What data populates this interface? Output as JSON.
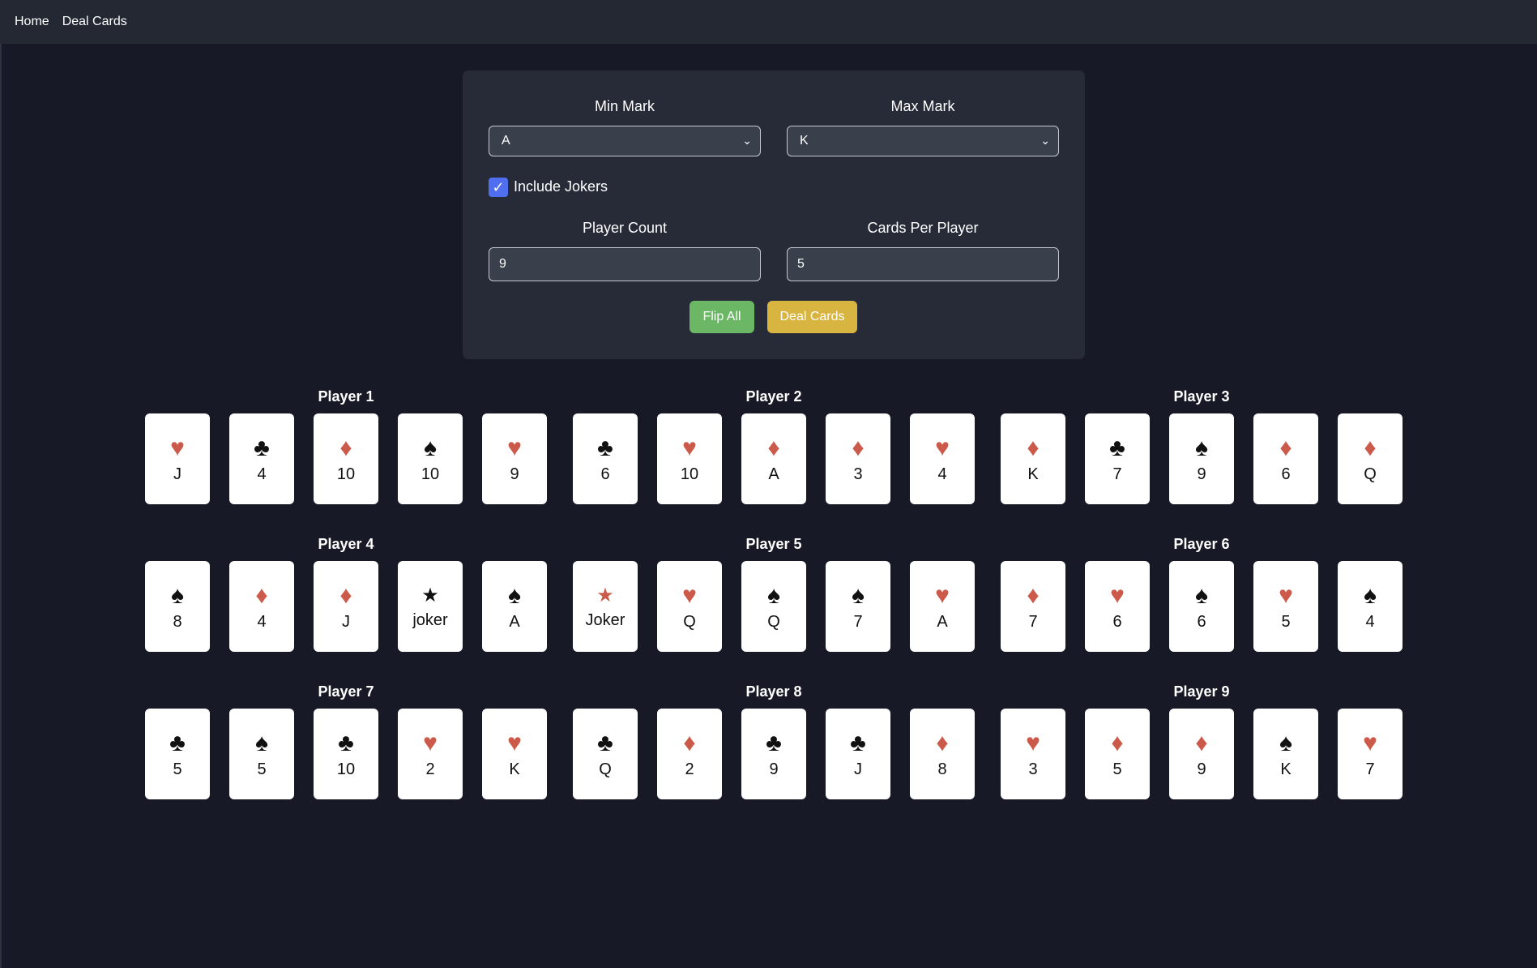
{
  "nav": {
    "home": "Home",
    "deal_cards": "Deal Cards"
  },
  "controls": {
    "min_mark_label": "Min Mark",
    "min_mark_value": "A",
    "max_mark_label": "Max Mark",
    "max_mark_value": "K",
    "include_jokers_label": "Include Jokers",
    "include_jokers_checked": true,
    "player_count_label": "Player Count",
    "player_count_value": "9",
    "cards_per_player_label": "Cards Per Player",
    "cards_per_player_value": "5",
    "flip_all_label": "Flip All",
    "deal_cards_label": "Deal Cards"
  },
  "colors": {
    "red_suit": "#cc5a4a",
    "flip_button": "#6cb766",
    "deal_button": "#d8b440",
    "checkbox": "#4f6ef0"
  },
  "players": [
    {
      "name": "Player 1",
      "cards": [
        {
          "suit": "heart",
          "mark": "J"
        },
        {
          "suit": "club",
          "mark": "4"
        },
        {
          "suit": "diamond",
          "mark": "10"
        },
        {
          "suit": "spade",
          "mark": "10"
        },
        {
          "suit": "heart",
          "mark": "9"
        }
      ]
    },
    {
      "name": "Player 2",
      "cards": [
        {
          "suit": "club",
          "mark": "6"
        },
        {
          "suit": "heart",
          "mark": "10"
        },
        {
          "suit": "diamond",
          "mark": "A"
        },
        {
          "suit": "diamond",
          "mark": "3"
        },
        {
          "suit": "heart",
          "mark": "4"
        }
      ]
    },
    {
      "name": "Player 3",
      "cards": [
        {
          "suit": "diamond",
          "mark": "K"
        },
        {
          "suit": "club",
          "mark": "7"
        },
        {
          "suit": "spade",
          "mark": "9"
        },
        {
          "suit": "diamond",
          "mark": "6"
        },
        {
          "suit": "diamond",
          "mark": "Q"
        }
      ]
    },
    {
      "name": "Player 4",
      "cards": [
        {
          "suit": "spade",
          "mark": "8"
        },
        {
          "suit": "diamond",
          "mark": "4"
        },
        {
          "suit": "diamond",
          "mark": "J"
        },
        {
          "suit": "joker-black",
          "mark": "joker"
        },
        {
          "suit": "spade",
          "mark": "A"
        }
      ]
    },
    {
      "name": "Player 5",
      "cards": [
        {
          "suit": "joker-red",
          "mark": "Joker"
        },
        {
          "suit": "heart",
          "mark": "Q"
        },
        {
          "suit": "spade",
          "mark": "Q"
        },
        {
          "suit": "spade",
          "mark": "7"
        },
        {
          "suit": "heart",
          "mark": "A"
        }
      ]
    },
    {
      "name": "Player 6",
      "cards": [
        {
          "suit": "diamond",
          "mark": "7"
        },
        {
          "suit": "heart",
          "mark": "6"
        },
        {
          "suit": "spade",
          "mark": "6"
        },
        {
          "suit": "heart",
          "mark": "5"
        },
        {
          "suit": "spade",
          "mark": "4"
        }
      ]
    },
    {
      "name": "Player 7",
      "cards": [
        {
          "suit": "club",
          "mark": "5"
        },
        {
          "suit": "spade",
          "mark": "5"
        },
        {
          "suit": "club",
          "mark": "10"
        },
        {
          "suit": "heart",
          "mark": "2"
        },
        {
          "suit": "heart",
          "mark": "K"
        }
      ]
    },
    {
      "name": "Player 8",
      "cards": [
        {
          "suit": "club",
          "mark": "Q"
        },
        {
          "suit": "diamond",
          "mark": "2"
        },
        {
          "suit": "club",
          "mark": "9"
        },
        {
          "suit": "club",
          "mark": "J"
        },
        {
          "suit": "diamond",
          "mark": "8"
        }
      ]
    },
    {
      "name": "Player 9",
      "cards": [
        {
          "suit": "heart",
          "mark": "3"
        },
        {
          "suit": "diamond",
          "mark": "5"
        },
        {
          "suit": "diamond",
          "mark": "9"
        },
        {
          "suit": "spade",
          "mark": "K"
        },
        {
          "suit": "heart",
          "mark": "7"
        }
      ]
    }
  ]
}
